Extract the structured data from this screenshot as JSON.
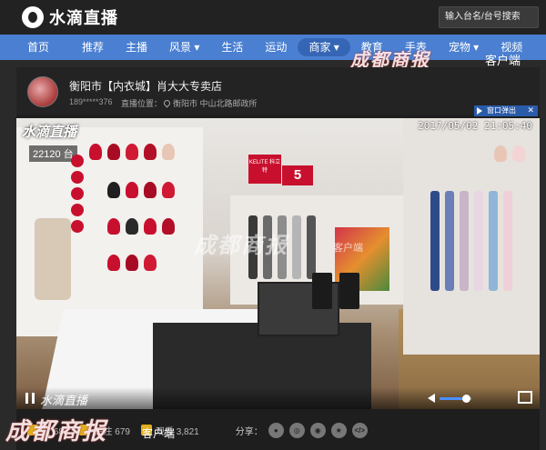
{
  "topbar": {
    "logo_text": "水滴直播",
    "search_placeholder": "输入台名/台号搜索"
  },
  "nav": {
    "items": [
      "首页",
      "推荐",
      "主播",
      "风景 ▾",
      "生活",
      "运动",
      "商家 ▾",
      "教育",
      "手表",
      "宠物 ▾",
      "视频"
    ],
    "active_index": 6
  },
  "watermark": {
    "main": "成都商报",
    "sub": "客户端"
  },
  "channel": {
    "title": "衡阳市【内衣城】肖大大专卖店",
    "phone": "189*****376",
    "location_label": "直播位置：",
    "location": "衡阳市 中山北路邮政所",
    "popout_label": "窗口弹出",
    "close_label": "✕"
  },
  "video": {
    "timestamp": "2017/05/02 21:05:40",
    "logo": "水滴直播",
    "viewer_count": "22120 台",
    "bottom_brand": "水滴直播",
    "volume": 0.8,
    "sign_kelite": "KELITE 科立特",
    "sign_5": "5",
    "in_video_watermark": "成都商报",
    "in_video_watermark_sub": "客户端"
  },
  "footer": {
    "stats": [
      {
        "icon": "thumb-icon",
        "label": "赞 683"
      },
      {
        "icon": "follow-icon",
        "label": "关注 679"
      },
      {
        "icon": "viewers-icon",
        "label": "观看 3,821"
      }
    ],
    "share_label": "分享：",
    "share_buttons": [
      "wechat-icon",
      "weibo-icon",
      "qq-icon",
      "qzone-icon",
      "embed-icon"
    ],
    "share_glyphs": [
      "●",
      "◎",
      "◉",
      "★",
      "</>"
    ]
  },
  "colors": {
    "nav_bg": "#4a7fd1",
    "accent": "#2a5ba8",
    "brand_red": "#c8102e"
  }
}
